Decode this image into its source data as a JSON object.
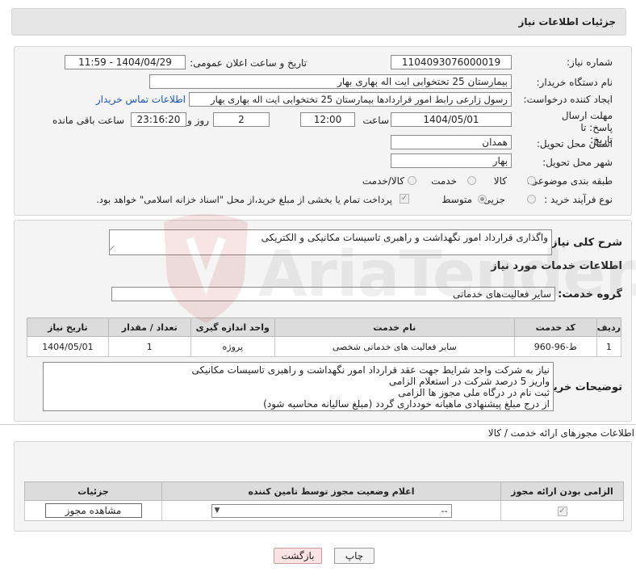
{
  "header": {
    "title": "جزئیات اطلاعات نیاز"
  },
  "form": {
    "need_number_label": "شماره نیاز:",
    "need_number": "1104093076000019",
    "announce_label": "تاریخ و ساعت اعلان عمومی:",
    "announce_value": "1404/04/29 - 11:59",
    "buyer_org_label": "نام دستگاه خریدار:",
    "buyer_org": "بیمارستان 25 تختخوابی ایت اله بهاری بهار",
    "requester_label": "ایجاد کننده درخواست:",
    "requester": "رسول زارعی رابط امور قراردادها بیمارستان 25 تختخوابی ایت اله بهاری بهار",
    "contact_link": "اطلاعات تماس خریدار",
    "deadline_label": "مهلت ارسال پاسخ: تا تاریخ:",
    "deadline_date": "1404/05/01",
    "time_label": "ساعت",
    "deadline_time": "12:00",
    "days_value": "2",
    "days_label": "روز و",
    "remaining_time": "23:16:20",
    "remaining_label": "ساعت باقی مانده",
    "province_label": "استان محل تحویل:",
    "province": "همدان",
    "city_label": "شهر محل تحویل:",
    "city": "بهار",
    "category_label": "طبقه بندی موضوعی:",
    "category_options": [
      "کالا",
      "خدمت",
      "کالا/خدمت"
    ],
    "process_label": "نوع فرآیند خرید :",
    "process_options": [
      "جزیی",
      "متوسط"
    ],
    "payment_note": "پرداخت تمام یا بخشی از مبلغ خرید،از محل \"اسناد خزانه اسلامی\" خواهد بود."
  },
  "summary": {
    "label": "شرح کلی نیاز:",
    "text": "واگذاری قرارداد امور نگهداشت و راهبری تاسیسات مکانیکی و الکتریکی"
  },
  "services": {
    "section_title": "اطلاعات خدمات مورد نیاز",
    "group_label": "گروه خدمت:",
    "group_value": "سایر فعالیت‌های خدماتی",
    "columns": [
      "ردیف",
      "کد خدمت",
      "نام خدمت",
      "واحد اندازه گیری",
      "تعداد / مقدار",
      "تاریخ نیاز"
    ],
    "rows": [
      {
        "row": "1",
        "code": "ط-96-960",
        "name": "سایر فعالیت های خدماتی شخصی",
        "unit": "پروژه",
        "qty": "1",
        "date": "1404/05/01"
      }
    ]
  },
  "buyer_notes": {
    "label": "توضیحات خریدار:",
    "lines": [
      "نیاز به شرکت واجد شرایط جهت عقد قرارداد امور نگهداشت و راهبری تاسیسات مکانیکی",
      "واریز 5  درصد شرکت در استعلام الزامی",
      "ثبت نام در درگاه ملی مجوز ها الزامی",
      "از درج مبلغ پیشنهادی ماهیانه خودداری گردد (مبلغ سالیانه محاسبه شود)"
    ]
  },
  "permits": {
    "section_title": "اطلاعات مجوزهای ارائه خدمت / کالا",
    "columns": [
      "الزامی بودن ارائه مجوز",
      "اعلام وضعیت مجوز توسط تامین کننده",
      "جزئیات"
    ],
    "select_value": "--",
    "view_button": "مشاهده مجوز"
  },
  "footer": {
    "print_button": "چاپ",
    "back_button": "بازگشت"
  },
  "watermark": {
    "text": "AriaTender.net"
  },
  "colors": {
    "header_bg": "#e6e6e6",
    "panel_bg": "#f4f4f4",
    "link": "#1a55b5",
    "back_btn": "#fbe3e3"
  }
}
